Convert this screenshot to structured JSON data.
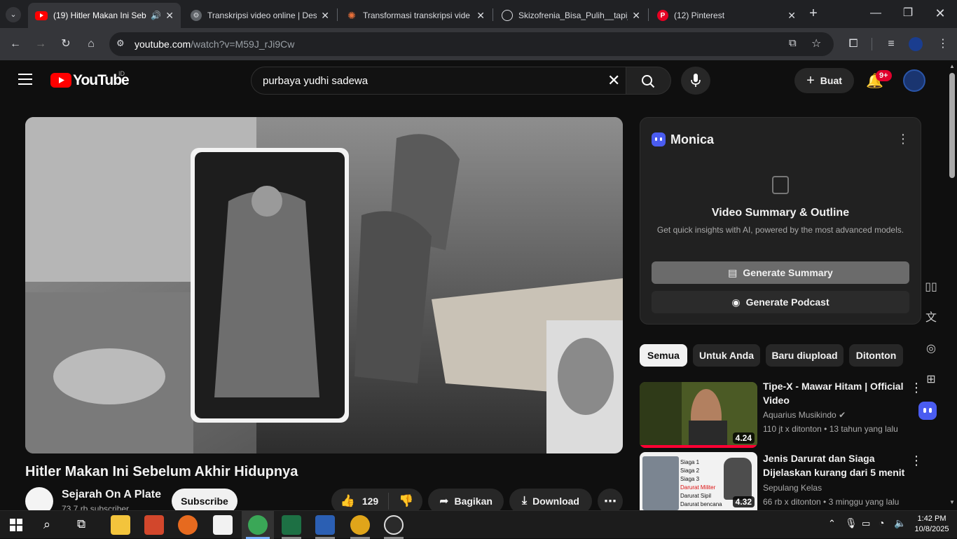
{
  "browser": {
    "tabs": [
      {
        "title": "(19) Hitler Makan Ini Seb",
        "active": true
      },
      {
        "title": "Transkripsi video online | Des"
      },
      {
        "title": "Transformasi transkripsi vide"
      },
      {
        "title": "Skizofrenia_Bisa_Pulih__tapi_"
      },
      {
        "title": "(12) Pinterest"
      }
    ],
    "url_host": "youtube.com",
    "url_path": "/watch?v=M59J_rJi9Cw"
  },
  "youtube": {
    "logo_text": "YouTube",
    "country": "ID",
    "search_query": "purbaya yudhi sadewa",
    "create_label": "Buat",
    "notif_count": "9+"
  },
  "video": {
    "title": "Hitler Makan Ini Sebelum Akhir Hidupnya",
    "channel": "Sejarah On A Plate",
    "subscribers": "73,7 rb subscriber",
    "subscribe_label": "Subscribe",
    "likes": "129",
    "share_label": "Bagikan",
    "download_label": "Download"
  },
  "monica": {
    "name": "Monica",
    "heading": "Video Summary & Outline",
    "subtitle": "Get quick insights with AI, powered by the most advanced models.",
    "summary_button": "Generate Summary",
    "podcast_button": "Generate Podcast"
  },
  "chips": [
    "Semua",
    "Untuk Anda",
    "Baru diupload",
    "Ditonton"
  ],
  "recommendations": [
    {
      "title": "Tipe-X - Mawar Hitam | Official Video",
      "channel": "Aquarius Musikindo",
      "meta": "110 jt x ditonton • 13 tahun yang lalu",
      "duration": "4.24"
    },
    {
      "title": "Jenis Darurat dan Siaga Dijelaskan kurang dari 5 menit",
      "channel": "Sepulang Kelas",
      "meta": "66 rb x ditonton • 3 minggu yang lalu",
      "duration": "4.32",
      "thumb_lines": [
        "Siaga 1",
        "Siaga 2",
        "Siaga 3",
        "Darurat Militer",
        "Darurat Sipil",
        "Darurat bencana"
      ]
    }
  ],
  "taskbar": {
    "time": "1:42 PM",
    "date": "10/8/2025"
  }
}
